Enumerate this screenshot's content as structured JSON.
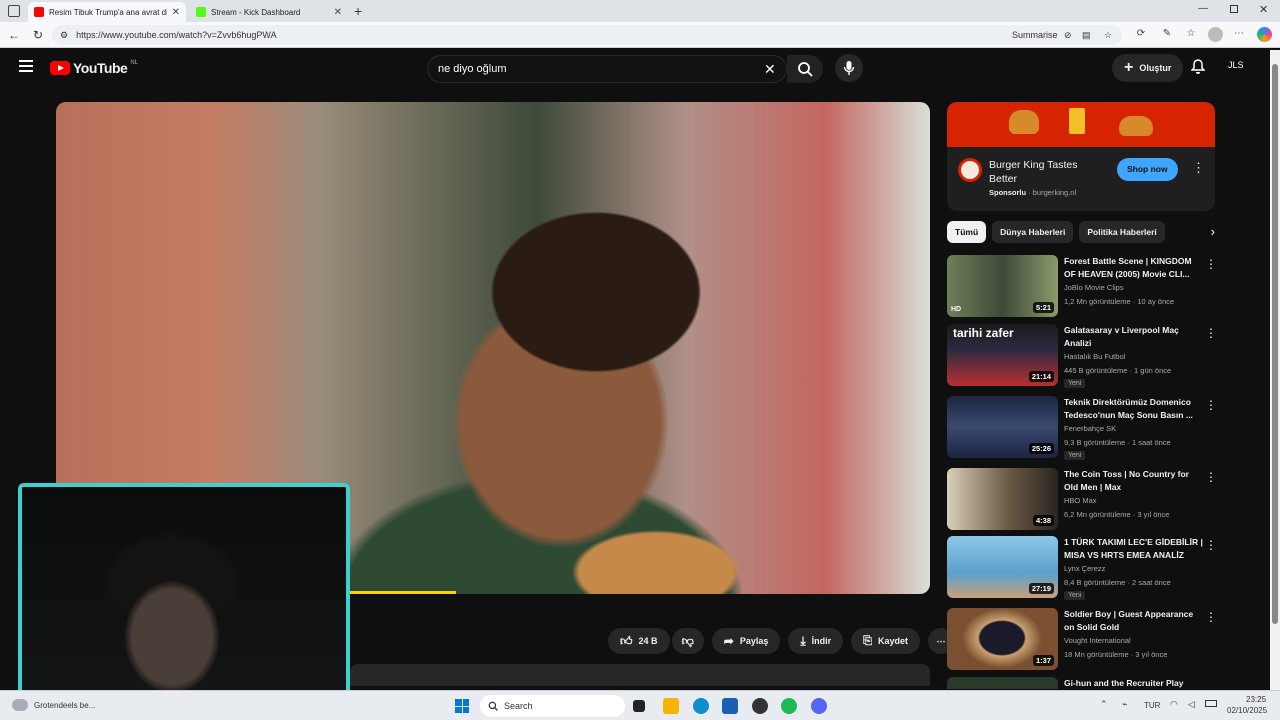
{
  "browser": {
    "tabs": [
      {
        "label": "Resim Tibuk Trump'a ana avrat di"
      },
      {
        "label": "Stream - Kick Dashboard"
      }
    ],
    "url": "https://www.youtube.com/watch?v=Zvvb6hugPWA",
    "summarise_label": "Summarise"
  },
  "youtube": {
    "logo_text": "YouTube",
    "region": "NL",
    "search_value": "ne diyo oğlum",
    "create_label": "Oluştur",
    "avatar_initials": "JLS"
  },
  "actions": {
    "like_count": "24 B",
    "share_label": "Paylaş",
    "download_label": "İndir",
    "save_label": "Kaydet"
  },
  "ad": {
    "title": "Burger King Tastes Better",
    "sponsored": "Sponsorlu",
    "domain": "burgerking.nl",
    "cta": "Shop now",
    "brand_color": "#d62300"
  },
  "chips": [
    "Tümü",
    "Dünya Haberleri",
    "Politika Haberleri"
  ],
  "videos": [
    {
      "title": "Forest Battle Scene | KINGDOM OF HEAVEN (2005) Movie CLI...",
      "channel": "JoBlo Movie Clips",
      "meta": "1,2 Mn görüntüleme · 10 ay önce",
      "duration": "5:21",
      "badge": ""
    },
    {
      "title": "Galatasaray v Liverpool Maç Analizi",
      "channel": "Hastalık Bu Futbol",
      "meta": "445 B görüntüleme · 1 gün önce",
      "duration": "21:14",
      "badge": "Yeni"
    },
    {
      "title": "Teknik Direktörümüz Domenico Tedesco'nun Maç Sonu Basın ...",
      "channel": "Fenerbahçe SK",
      "meta": "9,3 B görüntüleme · 1 saat önce",
      "duration": "25:26",
      "badge": "Yeni"
    },
    {
      "title": "The Coin Toss | No Country for Old Men | Max",
      "channel": "HBO Max",
      "meta": "6,2 Mn görüntüleme · 3 yıl önce",
      "duration": "4:38",
      "badge": ""
    },
    {
      "title": "1 TÜRK TAKIMI LEC'E GİDEBİLİR | MISA VS HRTS EMEA ANALİZ",
      "channel": "Lynx Çerezz",
      "meta": "8,4 B görüntüleme · 2 saat önce",
      "duration": "27:19",
      "badge": "Yeni"
    },
    {
      "title": "Soldier Boy | Guest Appearance on Solid Gold",
      "channel": "Vought International",
      "meta": "18 Mn görüntüleme · 3 yıl önce",
      "duration": "1:37",
      "badge": ""
    },
    {
      "title": "Gi-hun and the Recruiter Play",
      "channel": "",
      "meta": "",
      "duration": "",
      "badge": ""
    }
  ],
  "thumb_labels": {
    "t1": "tarihi zafer"
  },
  "taskbar": {
    "notification": "Grotendeels be...",
    "search_placeholder": "Search",
    "lang": "TUR",
    "time": "23:25",
    "date": "02/10/2025"
  }
}
